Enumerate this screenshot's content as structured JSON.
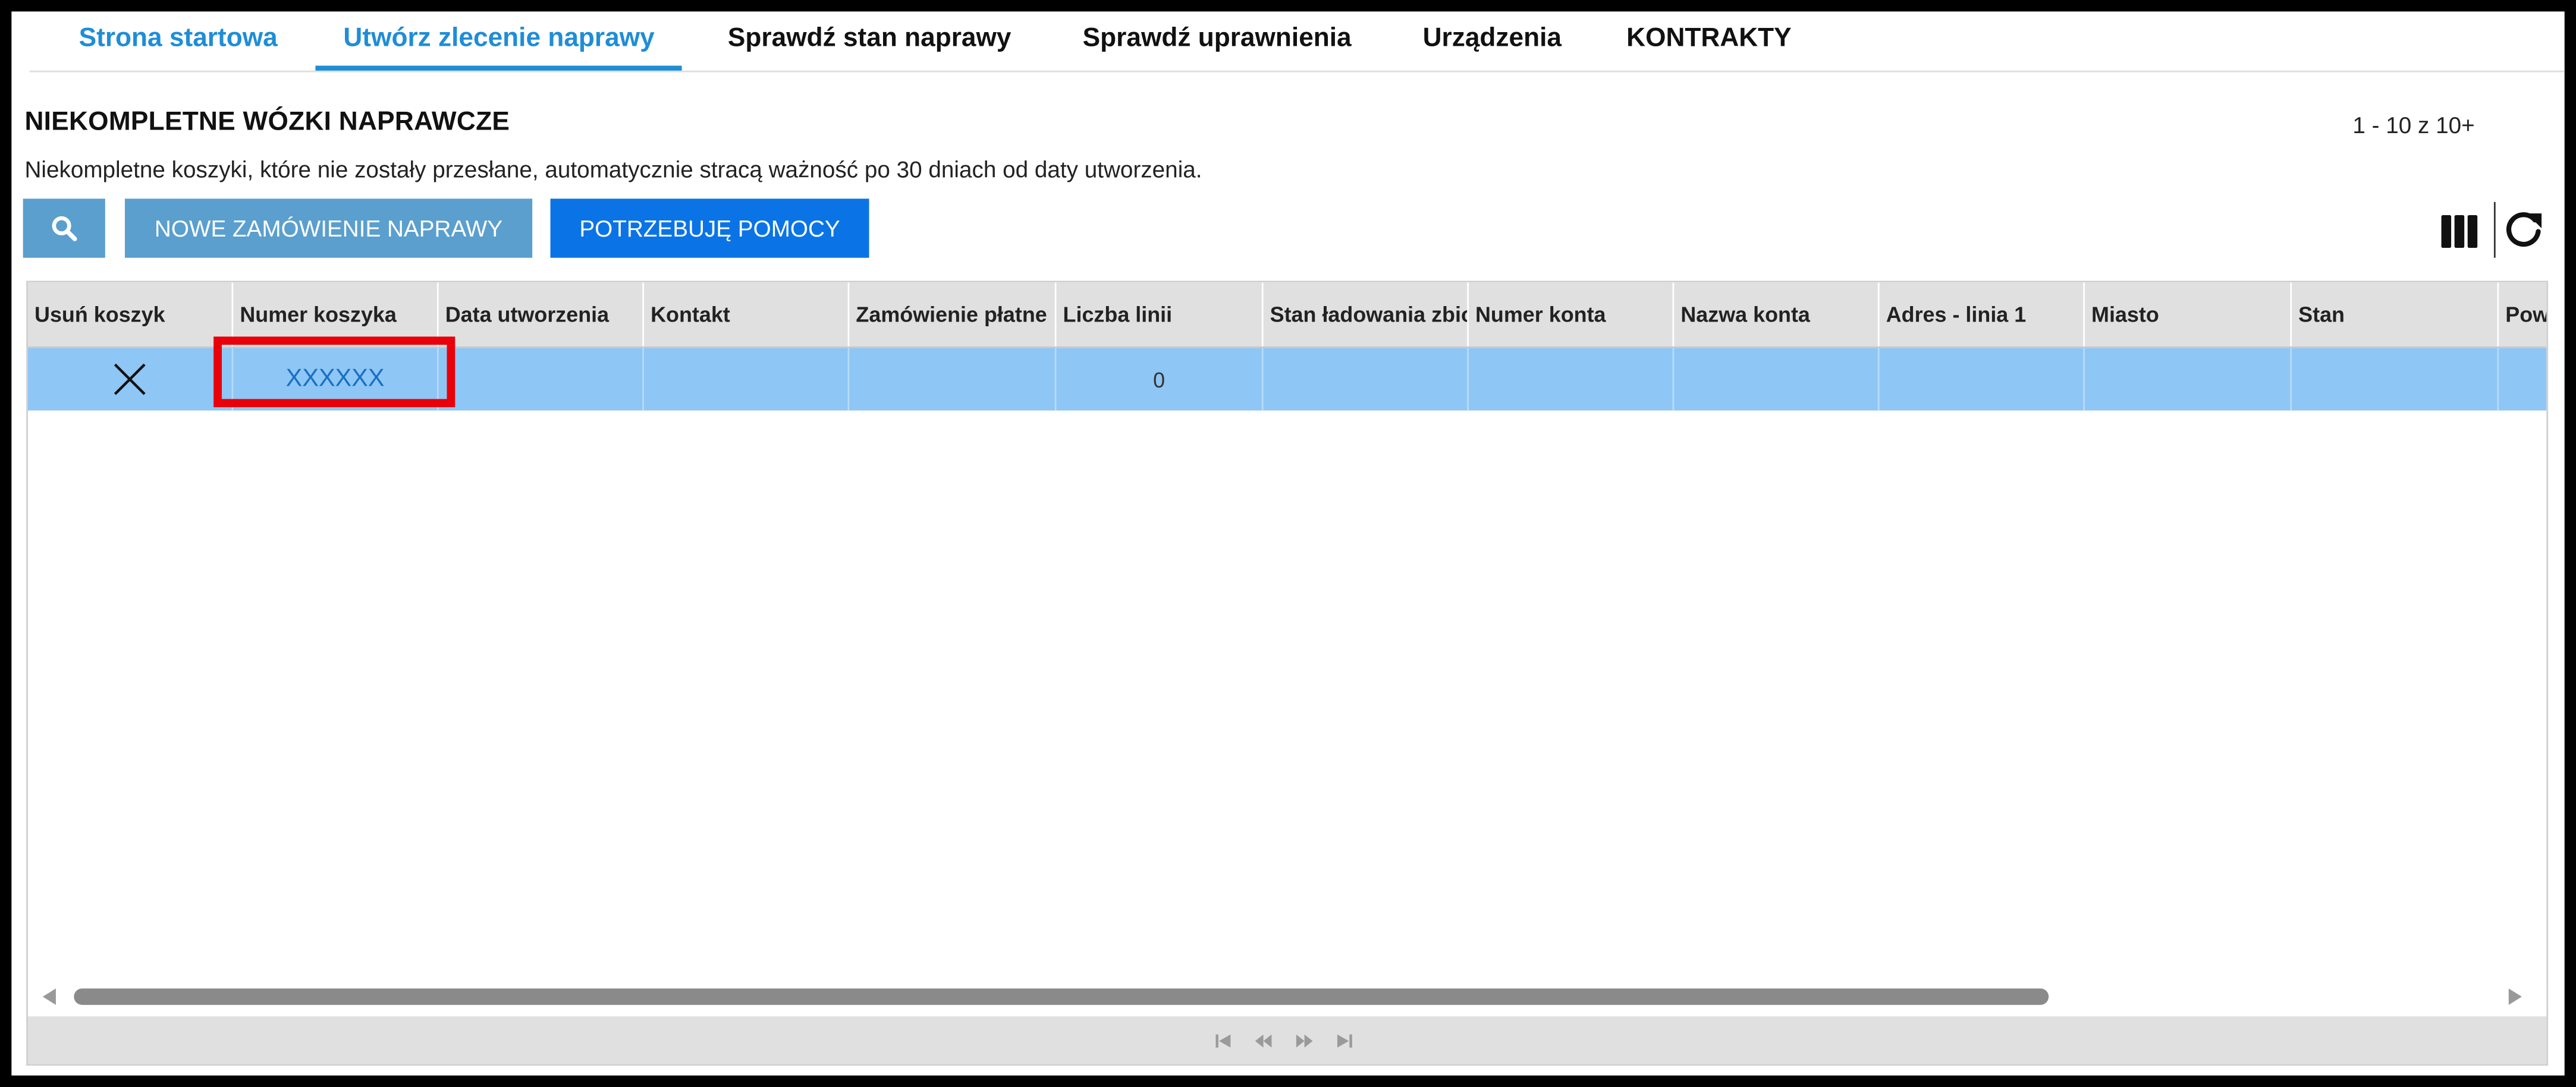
{
  "nav": {
    "tabs": [
      {
        "label": "Strona startowa"
      },
      {
        "label": "Utwórz zlecenie naprawy"
      },
      {
        "label": "Sprawdź stan naprawy"
      },
      {
        "label": "Sprawdź uprawnienia"
      },
      {
        "label": "Urządzenia"
      },
      {
        "label": "KONTRAKTY"
      }
    ],
    "active_tab": "Utwórz zlecenie naprawy"
  },
  "header": {
    "title": "NIEKOMPLETNE WÓZKI NAPRAWCZE",
    "subtitle": "Niekompletne koszyki, które nie zostały przesłane, automatycznie stracą ważność po 30 dniach od daty utworzenia.",
    "page_count": "1 - 10 z 10+"
  },
  "toolbar": {
    "search_icon": "search-icon",
    "new_order_label": "NOWE ZAMÓWIENIE NAPRAWY",
    "help_label": "POTRZEBUJĘ POMOCY",
    "columns_icon": "columns-icon",
    "refresh_icon": "refresh-icon"
  },
  "grid": {
    "columns": [
      "Usuń koszyk",
      "Numer koszyka",
      "Data utworzenia",
      "Kontakt",
      "Zamówienie płatne",
      "Liczba linii",
      "Stan ładowania zbio",
      "Numer konta",
      "Nazwa konta",
      "Adres - linia 1",
      "Miasto",
      "Stan",
      "Pow"
    ],
    "rows": [
      {
        "delete_icon": "close-icon",
        "cart_number": "XXXXXX",
        "created": "",
        "contact": "",
        "paid_order": "",
        "line_count": "0",
        "upload_status": "",
        "account_number": "",
        "account_name": "",
        "address_line_1": "",
        "city": "",
        "state": ""
      }
    ],
    "selected_row_color": "#8ec6f5"
  },
  "colors": {
    "accent": "#1f8dd6",
    "button_muted": "#5a9fce",
    "button_primary": "#0a74e6",
    "highlight_box": "#e8000b"
  }
}
